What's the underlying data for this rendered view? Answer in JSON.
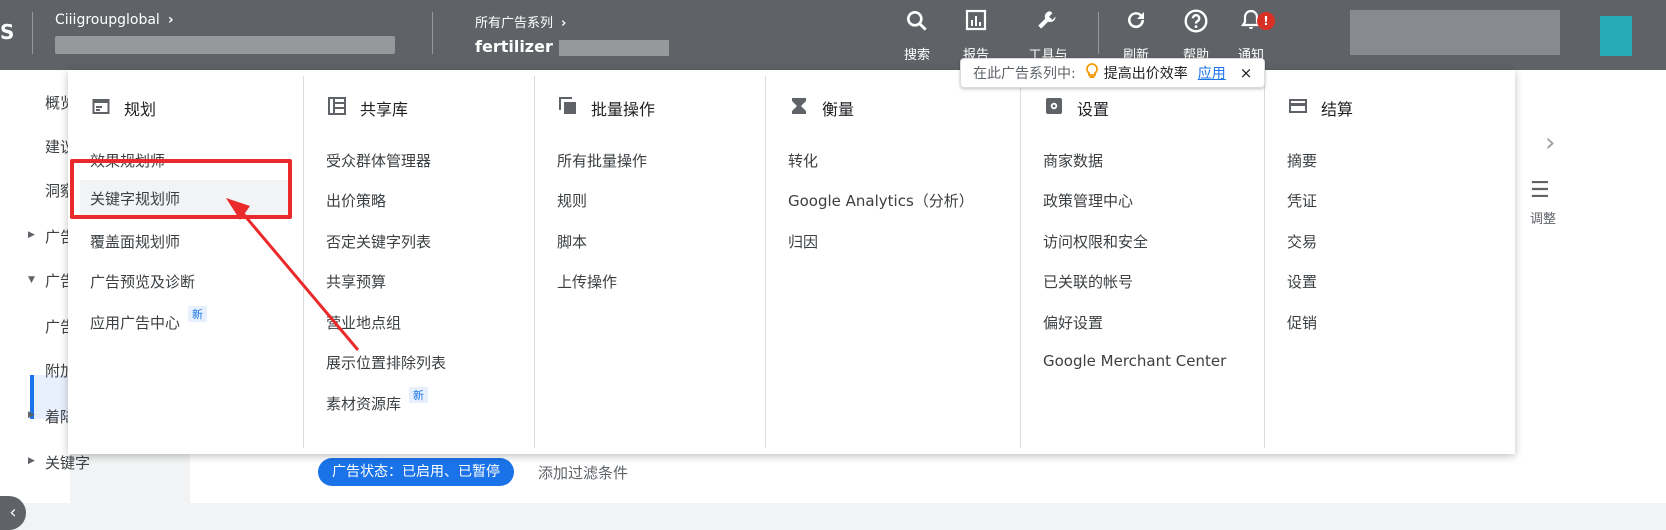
{
  "topbar": {
    "logo": "S",
    "account_label": "Ciiigroupglobal",
    "campaign_label": "所有广告系列",
    "campaign_value": "fertilizer",
    "tools": [
      {
        "icon": "search-icon",
        "label": "搜索"
      },
      {
        "icon": "reports-icon",
        "label": "报告"
      },
      {
        "icon": "wrench-icon",
        "label": "工具与"
      },
      {
        "icon": "refresh-icon",
        "label": "刷新"
      },
      {
        "icon": "help-icon",
        "label": "帮助"
      },
      {
        "icon": "bell-icon",
        "label": "通知"
      }
    ],
    "notification_badge": "!"
  },
  "leftnav": {
    "items": [
      "概览",
      "建议",
      "洞察",
      "广告",
      "广告",
      "广告",
      "附加",
      "着陆",
      "关键字"
    ]
  },
  "tooltip": {
    "prefix": "在此广告系列中:",
    "message": "提高出价效率",
    "apply": "应用",
    "close": "×"
  },
  "menu": {
    "columns": [
      {
        "key": "planning",
        "icon": "calendar-icon",
        "title": "规划",
        "items": [
          "效果规划师",
          "关键字规划师",
          "覆盖面规划师",
          "广告预览及诊断",
          "应用广告中心"
        ],
        "new_badge": "新"
      },
      {
        "key": "shared_library",
        "icon": "library-icon",
        "title": "共享库",
        "items": [
          "受众群体管理器",
          "出价策略",
          "否定关键字列表",
          "共享预算",
          "营业地点组",
          "展示位置排除列表",
          "素材资源库"
        ],
        "new_badge": "新"
      },
      {
        "key": "bulk_actions",
        "icon": "copy-icon",
        "title": "批量操作",
        "items": [
          "所有批量操作",
          "规则",
          "脚本",
          "上传操作"
        ]
      },
      {
        "key": "measurement",
        "icon": "hourglass-icon",
        "title": "衡量",
        "items": [
          "转化",
          "Google Analytics（分析）",
          "归因"
        ]
      },
      {
        "key": "setup",
        "icon": "gear-icon",
        "title": "设置",
        "items": [
          "商家数据",
          "政策管理中心",
          "访问权限和安全",
          "已关联的帐号",
          "偏好设置",
          "Google Merchant Center"
        ]
      },
      {
        "key": "billing",
        "icon": "card-icon",
        "title": "结算",
        "items": [
          "摘要",
          "凭证",
          "交易",
          "设置",
          "促销"
        ]
      }
    ]
  },
  "right_panel": {
    "adjust_label": "调整"
  },
  "filter_bar": {
    "status_chip": "广告状态：已启用、已暂停",
    "add_filter": "添加过滤条件"
  }
}
